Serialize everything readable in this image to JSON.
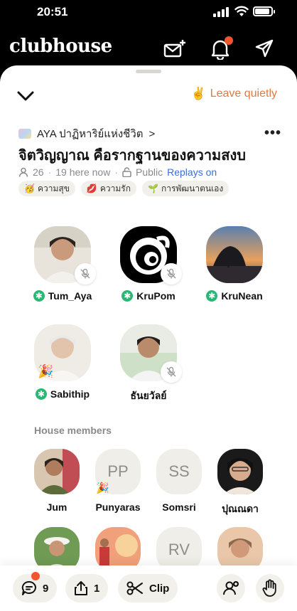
{
  "status_bar": {
    "time": "20:51"
  },
  "app": {
    "logo": "clubhouse"
  },
  "room": {
    "leave_label": "Leave quietly",
    "club_name": "AYA ปาฏิหาริย์แห่งชีวิต",
    "club_chevron": ">",
    "title": "จิตวิญญาณ คือรากฐานของความสงบ",
    "listeners": "26",
    "here_now": "19 here now",
    "visibility": "Public",
    "replays": "Replays on",
    "tags": [
      {
        "emoji": "🥳",
        "label": "ความสุข"
      },
      {
        "emoji": "💋",
        "label": "ความรัก"
      },
      {
        "emoji": "🌱",
        "label": "การพัฒนาตนเอง"
      }
    ]
  },
  "speakers": [
    {
      "name": "Tum_Aya",
      "moderator": true,
      "muted": true
    },
    {
      "name": "KruPom",
      "moderator": true,
      "muted": true
    },
    {
      "name": "KruNean",
      "moderator": true,
      "muted": false
    },
    {
      "name": "Sabithip",
      "moderator": true,
      "muted": false
    },
    {
      "name": "ธันยวัลย์",
      "moderator": false,
      "muted": true
    }
  ],
  "house_members": {
    "heading": "House members",
    "members": [
      {
        "name": "Jum",
        "initials": ""
      },
      {
        "name": "Punyaras",
        "initials": "PP"
      },
      {
        "name": "Somsri",
        "initials": "SS"
      },
      {
        "name": "ปุณณดา",
        "initials": ""
      },
      {
        "name": "",
        "initials": ""
      },
      {
        "name": "",
        "initials": ""
      },
      {
        "name": "",
        "initials": "RV"
      },
      {
        "name": "",
        "initials": ""
      }
    ]
  },
  "bottom_bar": {
    "chat_count": "9",
    "share_count": "1",
    "clip_label": "Clip"
  },
  "colors": {
    "accent_orange": "#e07a3f",
    "moderator_green": "#2bb673",
    "replays_blue": "#3a6fd8",
    "notification_red": "#f0552e"
  }
}
